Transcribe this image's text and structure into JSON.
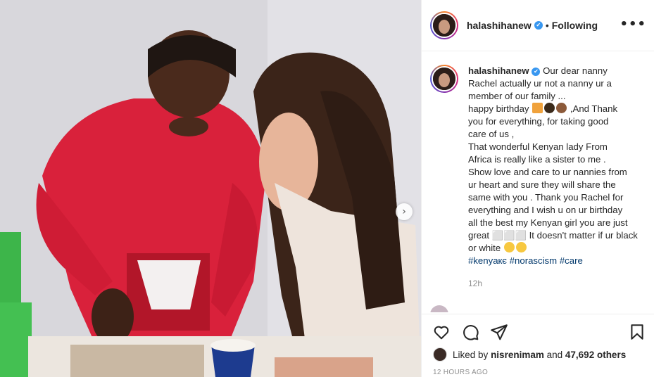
{
  "post": {
    "username": "halashihanew",
    "follow_status": "Following",
    "dot": "•",
    "more_icon": "more-horizontal-icon",
    "caption_lines": [
      "Our dear nanny",
      "Rachel actually ur not a nanny ur a",
      "member of our family ...",
      "happy birthday",
      ",And Thank",
      "you for everything, for taking good",
      "care of us ,",
      "That wonderful Kenyan lady From",
      "Africa is really like a sister to me .",
      "Show love and care to ur nannies from",
      "ur heart and sure they will share the",
      "same with you . Thank you Rachel for",
      "everything and I wish u on ur birthday",
      "all the best my Kenyan girl you are just",
      "great ⬜⬜⬜ It doesn't matter if ur black",
      "or white"
    ],
    "hashtags": [
      "#kenyaкє",
      "#norascism",
      "#care"
    ],
    "relative_time": "12h",
    "liked_by_prefix": "Liked by",
    "liked_by_user": "nisrenimam",
    "liked_by_and": "and",
    "liked_by_others": "47,692 others",
    "absolute_time": "12 HOURS AGO",
    "verified_badge": "✔",
    "next_arrow": "›"
  },
  "colors": {
    "link": "#00376b",
    "verified": "#3897f0",
    "muted": "#8e8e8e",
    "border": "#efefef"
  },
  "icons": {
    "like": "heart-icon",
    "comment": "comment-bubble-icon",
    "share": "paper-plane-icon",
    "save": "bookmark-icon"
  }
}
